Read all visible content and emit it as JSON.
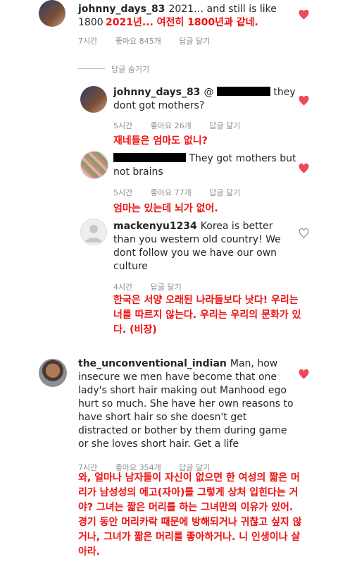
{
  "comments": [
    {
      "username": "johnny_days_83",
      "text": "2021… and still is like 1800",
      "translation": "2021년... 여전히 1800년과 같네.",
      "time": "7시간",
      "likes": "좋아요 845개",
      "reply": "답글 달기"
    },
    {
      "username": "johnny_days_83",
      "text": "they dont got mothers?",
      "translation": "재네들은 엄마도 없니?",
      "time": "5시간",
      "likes": "좋아요 26개",
      "reply": "답글 달기"
    },
    {
      "username": "",
      "text": "They got mothers but not brains",
      "translation": "엄마는 있는데 뇌가 없어.",
      "time": "5시간",
      "likes": "좋아요 77개",
      "reply": "답글 달기"
    },
    {
      "username": "mackenyu1234",
      "text": "Korea is better than you western old country! We dont follow you we have our own culture",
      "translation": "한국은 서양 오래된 나라들보다 낫다! 우리는 너를 따르지 않는다. 우리는 우리의 문화가 있다. (비장)",
      "time": "4시간",
      "reply": "답글 달기"
    },
    {
      "username": "the_unconventional_indian",
      "text": "Man, how insecure we men have become that one lady's short hair making out Manhood ego hurt so much. She have her own reasons to have short hair so she doesn't get distracted or bother by them during game or she loves short hair. Get a life",
      "translation": "와, 얼마나 남자들이 자신이 없으면 한 여성의 짧은 머리가 남성성의 에고(자아)를 그렇게 상처 입힌다는 거야? 그녀는 짧은 머리를 하는 그녀만의 이유가 있어. 경기 동안 머리카락 때문에 방해되거나 귀찮고 싶지 않거나, 그녀가 짧은 머리를 좋아하거나. 니 인생이나 살아라.",
      "time": "7시간",
      "likes": "좋아요 354개",
      "reply": "답글 달기"
    }
  ],
  "hide_replies": "답글 숨기기",
  "colors": {
    "accent_red": "#ed4956",
    "translation_red": "#ee1111",
    "meta_gray": "#8e8e8e"
  },
  "icons": [
    "heart-filled-icon",
    "heart-outline-icon",
    "user-placeholder-icon"
  ]
}
